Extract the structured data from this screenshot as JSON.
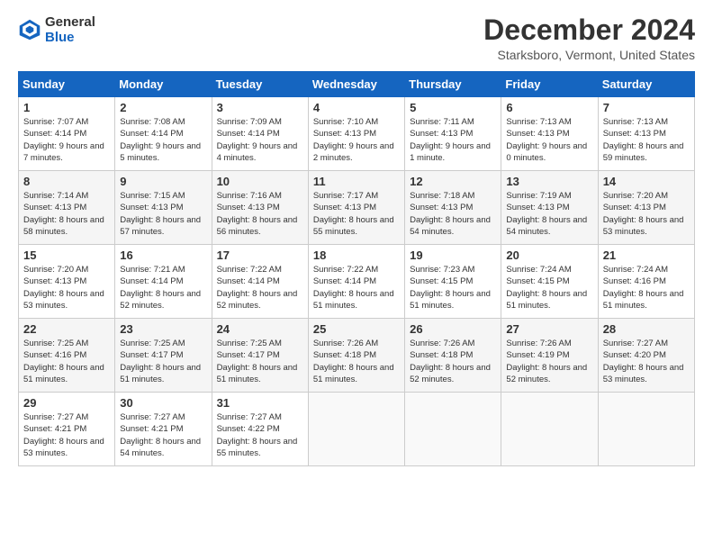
{
  "header": {
    "logo_general": "General",
    "logo_blue": "Blue",
    "title": "December 2024",
    "location": "Starksboro, Vermont, United States"
  },
  "days_of_week": [
    "Sunday",
    "Monday",
    "Tuesday",
    "Wednesday",
    "Thursday",
    "Friday",
    "Saturday"
  ],
  "weeks": [
    [
      {
        "day": "1",
        "sunrise": "Sunrise: 7:07 AM",
        "sunset": "Sunset: 4:14 PM",
        "daylight": "Daylight: 9 hours and 7 minutes."
      },
      {
        "day": "2",
        "sunrise": "Sunrise: 7:08 AM",
        "sunset": "Sunset: 4:14 PM",
        "daylight": "Daylight: 9 hours and 5 minutes."
      },
      {
        "day": "3",
        "sunrise": "Sunrise: 7:09 AM",
        "sunset": "Sunset: 4:14 PM",
        "daylight": "Daylight: 9 hours and 4 minutes."
      },
      {
        "day": "4",
        "sunrise": "Sunrise: 7:10 AM",
        "sunset": "Sunset: 4:13 PM",
        "daylight": "Daylight: 9 hours and 2 minutes."
      },
      {
        "day": "5",
        "sunrise": "Sunrise: 7:11 AM",
        "sunset": "Sunset: 4:13 PM",
        "daylight": "Daylight: 9 hours and 1 minute."
      },
      {
        "day": "6",
        "sunrise": "Sunrise: 7:13 AM",
        "sunset": "Sunset: 4:13 PM",
        "daylight": "Daylight: 9 hours and 0 minutes."
      },
      {
        "day": "7",
        "sunrise": "Sunrise: 7:13 AM",
        "sunset": "Sunset: 4:13 PM",
        "daylight": "Daylight: 8 hours and 59 minutes."
      }
    ],
    [
      {
        "day": "8",
        "sunrise": "Sunrise: 7:14 AM",
        "sunset": "Sunset: 4:13 PM",
        "daylight": "Daylight: 8 hours and 58 minutes."
      },
      {
        "day": "9",
        "sunrise": "Sunrise: 7:15 AM",
        "sunset": "Sunset: 4:13 PM",
        "daylight": "Daylight: 8 hours and 57 minutes."
      },
      {
        "day": "10",
        "sunrise": "Sunrise: 7:16 AM",
        "sunset": "Sunset: 4:13 PM",
        "daylight": "Daylight: 8 hours and 56 minutes."
      },
      {
        "day": "11",
        "sunrise": "Sunrise: 7:17 AM",
        "sunset": "Sunset: 4:13 PM",
        "daylight": "Daylight: 8 hours and 55 minutes."
      },
      {
        "day": "12",
        "sunrise": "Sunrise: 7:18 AM",
        "sunset": "Sunset: 4:13 PM",
        "daylight": "Daylight: 8 hours and 54 minutes."
      },
      {
        "day": "13",
        "sunrise": "Sunrise: 7:19 AM",
        "sunset": "Sunset: 4:13 PM",
        "daylight": "Daylight: 8 hours and 54 minutes."
      },
      {
        "day": "14",
        "sunrise": "Sunrise: 7:20 AM",
        "sunset": "Sunset: 4:13 PM",
        "daylight": "Daylight: 8 hours and 53 minutes."
      }
    ],
    [
      {
        "day": "15",
        "sunrise": "Sunrise: 7:20 AM",
        "sunset": "Sunset: 4:13 PM",
        "daylight": "Daylight: 8 hours and 53 minutes."
      },
      {
        "day": "16",
        "sunrise": "Sunrise: 7:21 AM",
        "sunset": "Sunset: 4:14 PM",
        "daylight": "Daylight: 8 hours and 52 minutes."
      },
      {
        "day": "17",
        "sunrise": "Sunrise: 7:22 AM",
        "sunset": "Sunset: 4:14 PM",
        "daylight": "Daylight: 8 hours and 52 minutes."
      },
      {
        "day": "18",
        "sunrise": "Sunrise: 7:22 AM",
        "sunset": "Sunset: 4:14 PM",
        "daylight": "Daylight: 8 hours and 51 minutes."
      },
      {
        "day": "19",
        "sunrise": "Sunrise: 7:23 AM",
        "sunset": "Sunset: 4:15 PM",
        "daylight": "Daylight: 8 hours and 51 minutes."
      },
      {
        "day": "20",
        "sunrise": "Sunrise: 7:24 AM",
        "sunset": "Sunset: 4:15 PM",
        "daylight": "Daylight: 8 hours and 51 minutes."
      },
      {
        "day": "21",
        "sunrise": "Sunrise: 7:24 AM",
        "sunset": "Sunset: 4:16 PM",
        "daylight": "Daylight: 8 hours and 51 minutes."
      }
    ],
    [
      {
        "day": "22",
        "sunrise": "Sunrise: 7:25 AM",
        "sunset": "Sunset: 4:16 PM",
        "daylight": "Daylight: 8 hours and 51 minutes."
      },
      {
        "day": "23",
        "sunrise": "Sunrise: 7:25 AM",
        "sunset": "Sunset: 4:17 PM",
        "daylight": "Daylight: 8 hours and 51 minutes."
      },
      {
        "day": "24",
        "sunrise": "Sunrise: 7:25 AM",
        "sunset": "Sunset: 4:17 PM",
        "daylight": "Daylight: 8 hours and 51 minutes."
      },
      {
        "day": "25",
        "sunrise": "Sunrise: 7:26 AM",
        "sunset": "Sunset: 4:18 PM",
        "daylight": "Daylight: 8 hours and 51 minutes."
      },
      {
        "day": "26",
        "sunrise": "Sunrise: 7:26 AM",
        "sunset": "Sunset: 4:18 PM",
        "daylight": "Daylight: 8 hours and 52 minutes."
      },
      {
        "day": "27",
        "sunrise": "Sunrise: 7:26 AM",
        "sunset": "Sunset: 4:19 PM",
        "daylight": "Daylight: 8 hours and 52 minutes."
      },
      {
        "day": "28",
        "sunrise": "Sunrise: 7:27 AM",
        "sunset": "Sunset: 4:20 PM",
        "daylight": "Daylight: 8 hours and 53 minutes."
      }
    ],
    [
      {
        "day": "29",
        "sunrise": "Sunrise: 7:27 AM",
        "sunset": "Sunset: 4:21 PM",
        "daylight": "Daylight: 8 hours and 53 minutes."
      },
      {
        "day": "30",
        "sunrise": "Sunrise: 7:27 AM",
        "sunset": "Sunset: 4:21 PM",
        "daylight": "Daylight: 8 hours and 54 minutes."
      },
      {
        "day": "31",
        "sunrise": "Sunrise: 7:27 AM",
        "sunset": "Sunset: 4:22 PM",
        "daylight": "Daylight: 8 hours and 55 minutes."
      },
      null,
      null,
      null,
      null
    ]
  ]
}
